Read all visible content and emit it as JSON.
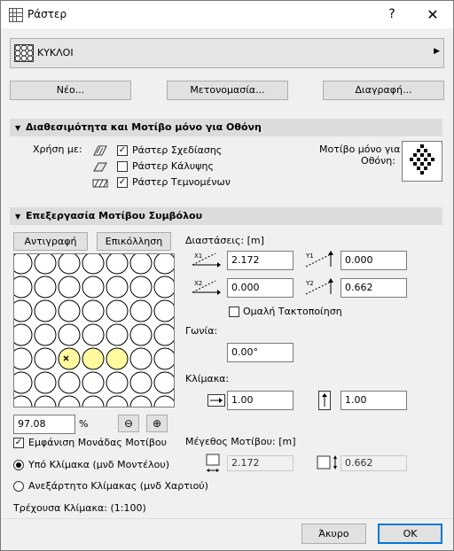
{
  "window": {
    "title": "Ράστερ",
    "help": "?",
    "close": "✕"
  },
  "fill_selector": {
    "selected": "ΚΥΚΛΟΙ"
  },
  "top_buttons": {
    "new": "Νέο...",
    "rename": "Μετονομασία...",
    "delete": "Διαγραφή..."
  },
  "section_availability": {
    "header": "Διαθεσιμότητα και Μοτίβο μόνο για Οθόνη",
    "use_with_label": "Χρήση με:",
    "drafting_fills": {
      "label": "Ράστερ Σχεδίασης",
      "checked": true
    },
    "cover_fills": {
      "label": "Ράστερ Κάλυψης",
      "checked": false
    },
    "cut_fills": {
      "label": "Ράστερ Τεμνομένων",
      "checked": true
    },
    "screen_pattern_label_1": "Μοτίβο μόνο για",
    "screen_pattern_label_2": "Οθόνη:"
  },
  "section_edit": {
    "header": "Επεξεργασία Μοτίβου Συμβόλου",
    "copy_button": "Αντιγραφή",
    "paste_button": "Επικόλληση",
    "zoom_value": "97.08",
    "zoom_unit": "%",
    "show_unit": {
      "label": "Εμφάνιση Μονάδας Μοτίβου",
      "checked": true
    },
    "radio_model": {
      "label": "Υπό Κλίμακα (μνδ Μοντέλου)",
      "selected": true
    },
    "radio_paper": {
      "label": "Ανεξάρτητο Κλίμακας (μνδ Χαρτιού)",
      "selected": false
    },
    "current_scale": "Τρέχουσα Κλίμακα: (1:100)",
    "dimensions_label": "Διαστάσεις: [m]",
    "x1": "2.172",
    "y1": "0.000",
    "x2": "0.000",
    "y2": "0.662",
    "smooth_spacing": {
      "label": "Ομαλή Τακτοποίηση",
      "checked": false
    },
    "angle_label": "Γωνία:",
    "angle": "0.00°",
    "scale_label": "Κλίμακα:",
    "scale_x": "1.00",
    "scale_y": "1.00",
    "pattern_size_label": "Μέγεθος Μοτίβου: [m]",
    "size_x": "2.172",
    "size_y": "0.662"
  },
  "footer": {
    "cancel": "Άκυρο",
    "ok": "OK"
  },
  "colors": {
    "highlight_circle": "#fffaa0",
    "section_bg": "#dcdcdc",
    "dialog_bg": "#f0f0f0",
    "ok_border": "#0078d7"
  }
}
